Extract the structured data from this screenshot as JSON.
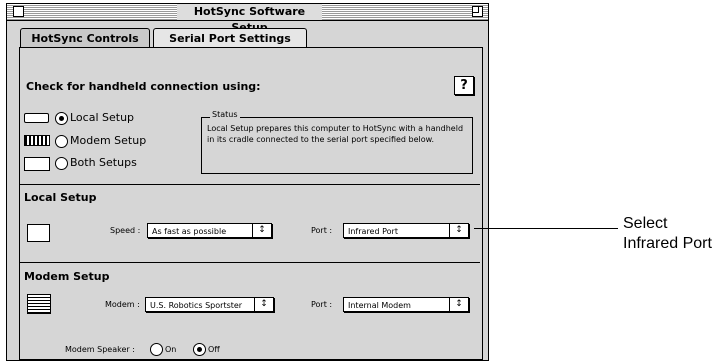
{
  "window": {
    "title": "HotSync Software Setup"
  },
  "tabs": [
    {
      "label": "HotSync Controls"
    },
    {
      "label": "Serial Port Settings"
    }
  ],
  "check": {
    "heading": "Check for handheld connection using:",
    "help_label": "?",
    "options": [
      {
        "label": "Local Setup",
        "selected": true
      },
      {
        "label": "Modem Setup",
        "selected": false
      },
      {
        "label": "Both Setups",
        "selected": false
      }
    ],
    "status_title": "Status",
    "status_text": "Local Setup prepares this computer to HotSync with a handheld in its cradle connected to the serial port specified below."
  },
  "local_setup": {
    "heading": "Local Setup",
    "speed_label": "Speed :",
    "speed_value": "As fast as possible",
    "port_label": "Port :",
    "port_value": "Infrared Port"
  },
  "modem_setup": {
    "heading": "Modem Setup",
    "modem_label": "Modem :",
    "modem_value": "U.S. Robotics Sportster",
    "port_label": "Port :",
    "port_value": "Internal Modem",
    "speaker_label": "Modem Speaker :",
    "speaker_options": [
      {
        "label": "On",
        "selected": false
      },
      {
        "label": "Off",
        "selected": true
      }
    ]
  },
  "callout": {
    "text": "Select Infrared Port"
  },
  "icons": {
    "popup_arrow": "updown-arrows-icon"
  }
}
